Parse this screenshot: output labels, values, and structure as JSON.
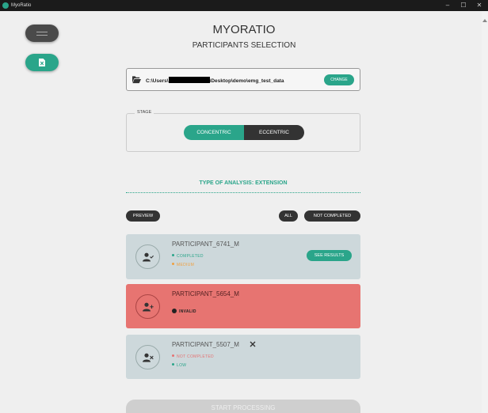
{
  "titlebar": {
    "title": "MyoRatio",
    "minimize": "–",
    "maximize": "☐",
    "close": "✕"
  },
  "sidebar": {
    "menu_icon": "menu-icon",
    "file_icon": "excel-file-icon"
  },
  "header": {
    "app_name": "MYORATIO",
    "page_title": "PARTICIPANTS SELECTION"
  },
  "folder": {
    "path_prefix": "C:\\Users\\",
    "path_suffix": "\\Desktop\\demo\\emg_test_data",
    "change_label": "CHANGE"
  },
  "stage": {
    "legend": "STAGE",
    "options": [
      "CONCENTRIC",
      "ECCENTRIC"
    ],
    "selected": "CONCENTRIC"
  },
  "analysis": {
    "title": "TYPE OF ANALYSIS: EXTENSION"
  },
  "controls": {
    "preview": "PREVIEW",
    "all": "ALL",
    "not_completed": "NOT COMPLETED"
  },
  "participants": [
    {
      "name": "PARTICIPANT_6741_M",
      "status": "COMPLETED",
      "quality": "MEDIUM",
      "action": "SEE RESULTS"
    },
    {
      "name": "PARTICIPANT_5654_M",
      "status": "INVALID"
    },
    {
      "name": "PARTICIPANT_5507_M",
      "status": "NOT COMPLETED",
      "quality": "LOW"
    }
  ],
  "footer": {
    "start_label": "START PROCESSING"
  },
  "colors": {
    "accent": "#2aa58a",
    "invalid": "#e77471",
    "card": "#cdd8db",
    "dark": "#333333"
  }
}
